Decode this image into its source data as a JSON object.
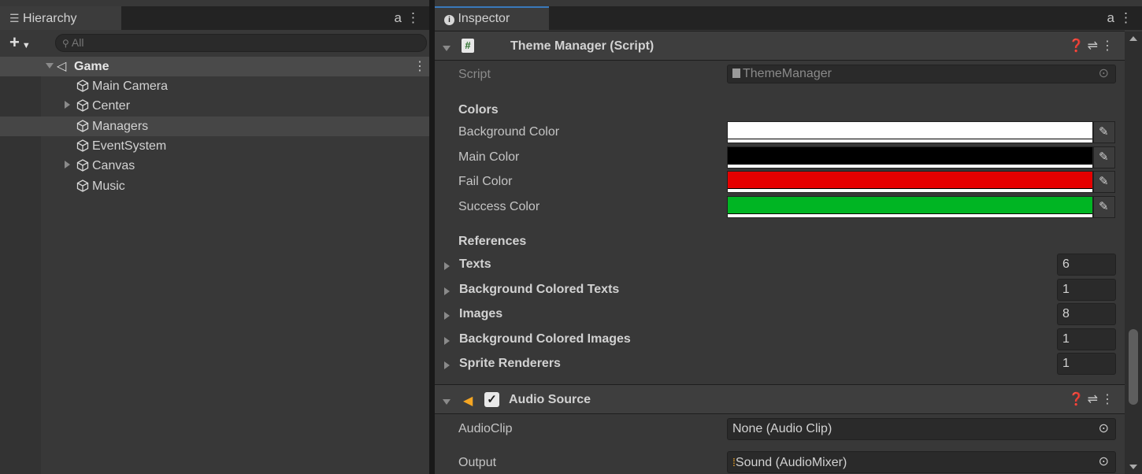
{
  "hierarchy": {
    "tab_title": "Hierarchy",
    "search_placeholder": "All",
    "root": "Game",
    "items": [
      {
        "label": "Main Camera",
        "expandable": false
      },
      {
        "label": "Center",
        "expandable": true
      },
      {
        "label": "Managers",
        "expandable": false,
        "selected": true
      },
      {
        "label": "EventSystem",
        "expandable": false
      },
      {
        "label": "Canvas",
        "expandable": true
      },
      {
        "label": "Music",
        "expandable": false
      }
    ]
  },
  "inspector": {
    "tab_title": "Inspector",
    "theme_manager": {
      "title": "Theme Manager (Script)",
      "script_label": "Script",
      "script_value": "ThemeManager",
      "colors_header": "Colors",
      "colors": [
        {
          "label": "Background Color",
          "hex": "#ffffff"
        },
        {
          "label": "Main Color",
          "hex": "#000000"
        },
        {
          "label": "Fail Color",
          "hex": "#e50000"
        },
        {
          "label": "Success Color",
          "hex": "#00b523"
        }
      ],
      "references_header": "References",
      "references": [
        {
          "label": "Texts",
          "count": "6"
        },
        {
          "label": "Background Colored Texts",
          "count": "1"
        },
        {
          "label": "Images",
          "count": "8"
        },
        {
          "label": "Background Colored Images",
          "count": "1"
        },
        {
          "label": "Sprite Renderers",
          "count": "1"
        }
      ]
    },
    "audio_source": {
      "title": "Audio Source",
      "enabled": true,
      "clip_label": "AudioClip",
      "clip_value": "None (Audio Clip)",
      "output_label": "Output",
      "output_value": "Sound (AudioMixer)"
    }
  },
  "theme": {
    "accent": "#3a79bb",
    "selected_row": "#464646",
    "audio_icon": "#f5a623"
  }
}
